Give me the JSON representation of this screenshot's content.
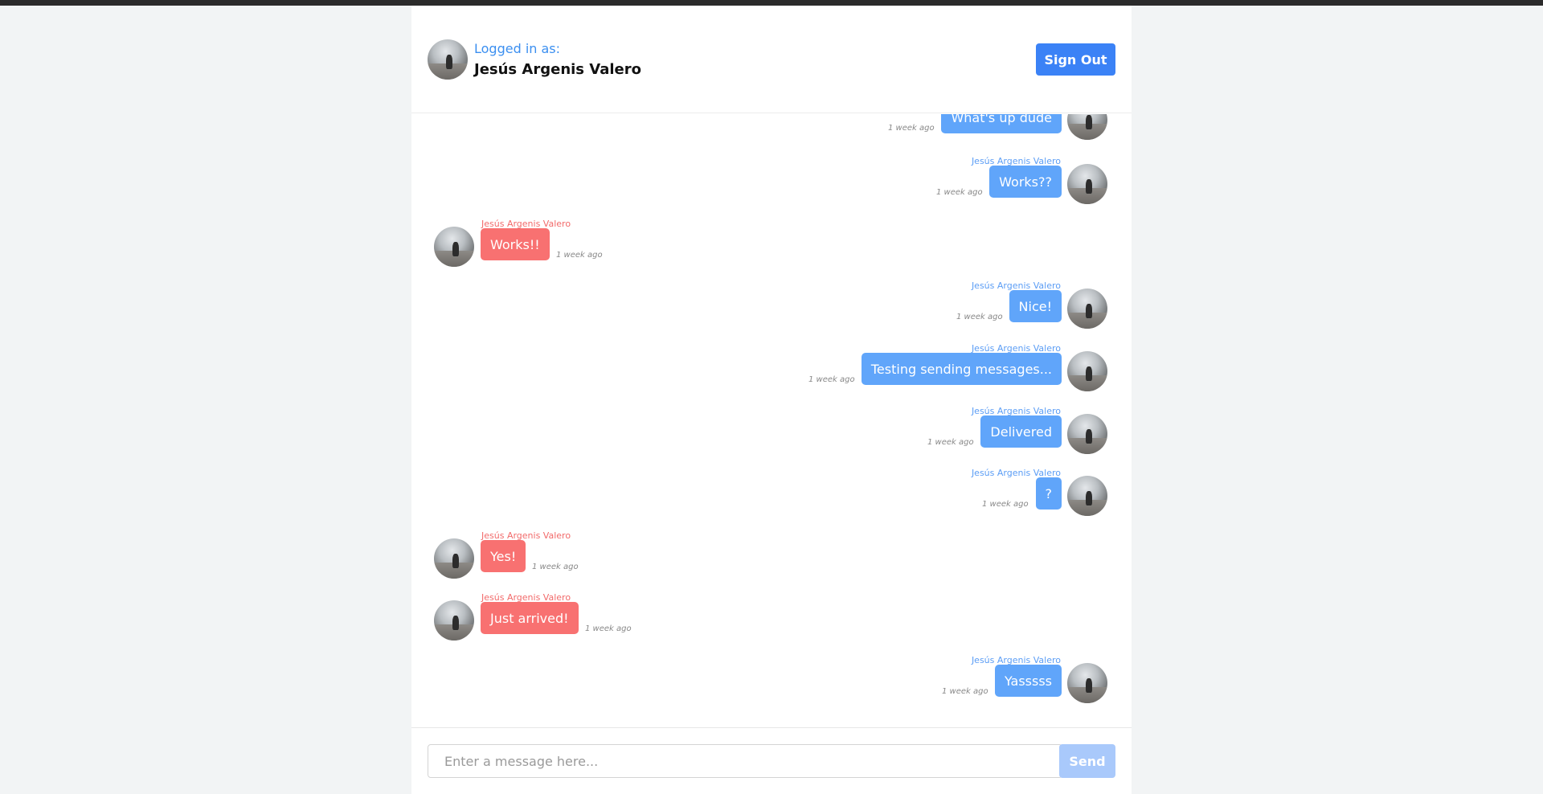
{
  "header": {
    "logged_in_label": "Logged in as:",
    "user_name": "Jesús Argenis Valero",
    "sign_out_label": "Sign Out"
  },
  "messages": [
    {
      "side": "right",
      "sender": "",
      "text": "What's up dude",
      "time": "1 week ago"
    },
    {
      "side": "right",
      "sender": "Jesús Argenis Valero",
      "text": "Works??",
      "time": "1 week ago"
    },
    {
      "side": "left",
      "sender": "Jesús Argenis Valero",
      "text": "Works!!",
      "time": "1 week ago"
    },
    {
      "side": "right",
      "sender": "Jesús Argenis Valero",
      "text": "Nice!",
      "time": "1 week ago"
    },
    {
      "side": "right",
      "sender": "Jesús Argenis Valero",
      "text": "Testing sending messages...",
      "time": "1 week ago"
    },
    {
      "side": "right",
      "sender": "Jesús Argenis Valero",
      "text": "Delivered",
      "time": "1 week ago"
    },
    {
      "side": "right",
      "sender": "Jesús Argenis Valero",
      "text": "?",
      "time": "1 week ago"
    },
    {
      "side": "left",
      "sender": "Jesús Argenis Valero",
      "text": "Yes!",
      "time": "1 week ago"
    },
    {
      "side": "left",
      "sender": "Jesús Argenis Valero",
      "text": "Just arrived!",
      "time": "1 week ago"
    },
    {
      "side": "right",
      "sender": "Jesús Argenis Valero",
      "text": "Yasssss",
      "time": "1 week ago"
    }
  ],
  "composer": {
    "placeholder": "Enter a message here...",
    "value": "",
    "send_label": "Send"
  },
  "colors": {
    "own_bubble": "#60a5fa",
    "other_bubble": "#f87171",
    "accent": "#3b82f6"
  }
}
